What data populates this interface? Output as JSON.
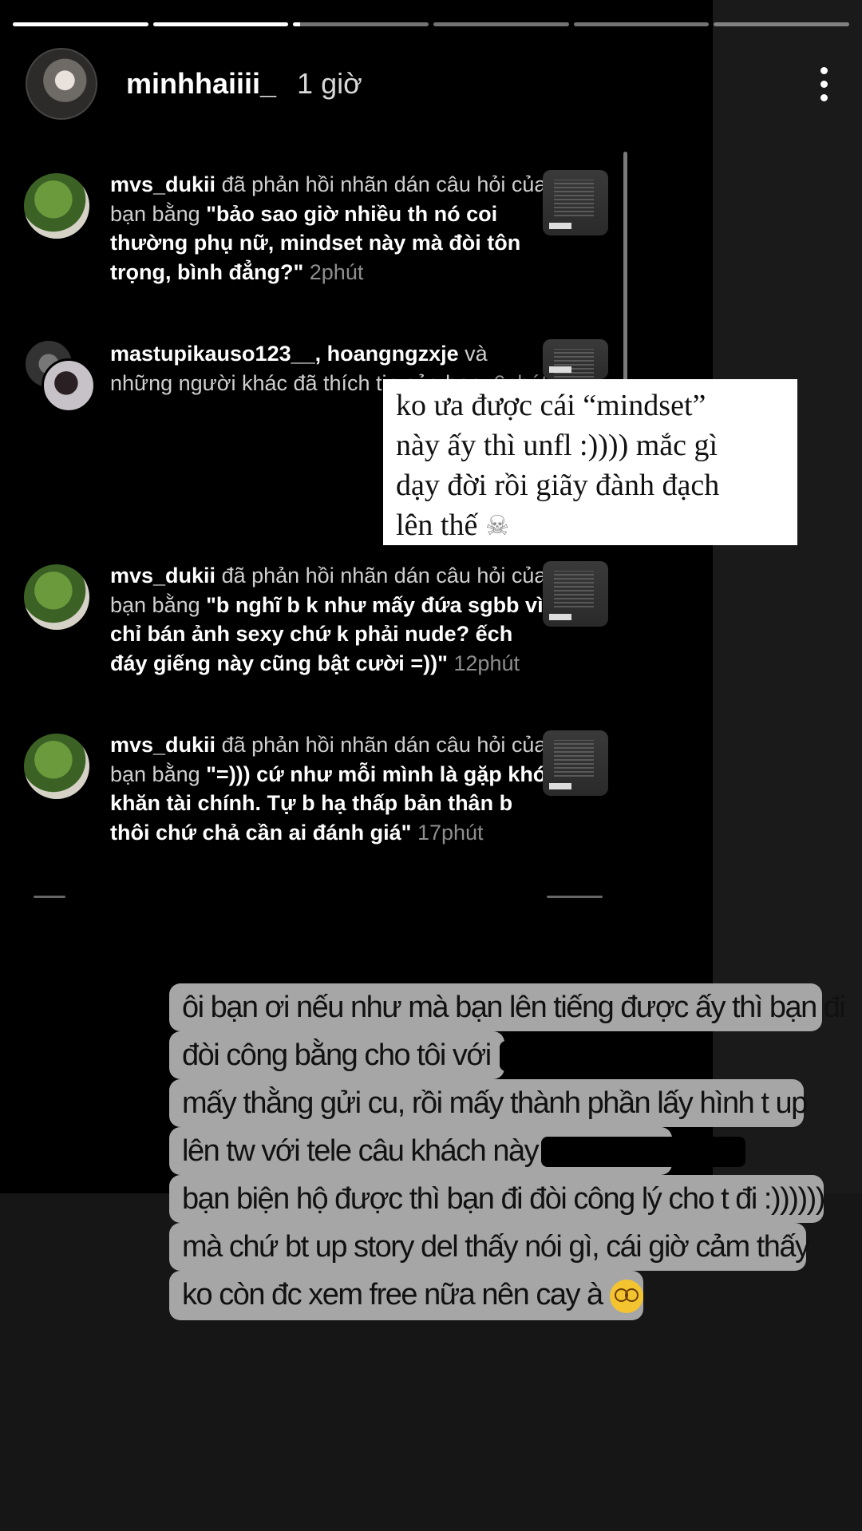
{
  "story": {
    "progress": [
      1,
      1,
      0.05,
      0,
      0,
      0
    ],
    "username": "minhhaiiii_",
    "time": "1 giờ"
  },
  "notifications": [
    {
      "username": "mvs_dukii",
      "action": " đã phản hồi nhãn dán câu hỏi của bạn bằng ",
      "quote": "\"bảo sao giờ nhiều th nó coi thường phụ nữ, mindset này mà đòi tôn trọng, bình đẳng?\"",
      "ago": "2phút"
    },
    {
      "usernames": "mastupikauso123__, hoangngzxje",
      "action": " và những người khác đã thích tin của bạn. ",
      "ago": "6phút"
    },
    {
      "username": "mvs_dukii",
      "action": " đã phản hồi nhãn dán câu hỏi của bạn bằng ",
      "quote": "\"b nghĩ b k như mấy đứa sgbb vì chỉ bán ảnh sexy chứ k phải nude? ếch đáy giếng này cũng bật cười =))\"",
      "ago": "12phút"
    },
    {
      "username": "mvs_dukii",
      "action": " đã phản hồi nhãn dán câu hỏi của bạn bằng ",
      "quote": "\"=))) cứ như mỗi mình là gặp khó khăn tài chính. Tự b hạ thấp bản thân b thôi chứ chả cần ai đánh giá\"",
      "ago": "17phút"
    }
  ],
  "caption": {
    "line1": "ko ưa được cái “mindset”",
    "line2": "này ấy thì unfl :)))) mắc gì",
    "line3": "dạy đời rồi giãy đành đạch",
    "line4": "lên thế",
    "emoji": "skull-emoji"
  },
  "message": {
    "lines": [
      "ôi bạn ơi nếu như mà bạn lên tiếng được ấy thì bạn đi",
      "đòi công bằng cho tôi với",
      "mấy thằng gửi cu, rồi mấy thành phần lấy hình t up",
      "lên tw với tele câu khách này",
      "bạn biện hộ được thì bạn đi đòi công lý cho t đi :))))))",
      "mà chứ bt up story del thấy nói gì, cái giờ cảm thấy",
      "ko còn đc xem free nữa nên cay à"
    ],
    "emoji": "dizzy-face-emoji"
  },
  "colors": {
    "background": "#000000",
    "bubble": "#a6a6a6",
    "caption_bg": "#ffffff",
    "muted": "#8e8e8e"
  }
}
